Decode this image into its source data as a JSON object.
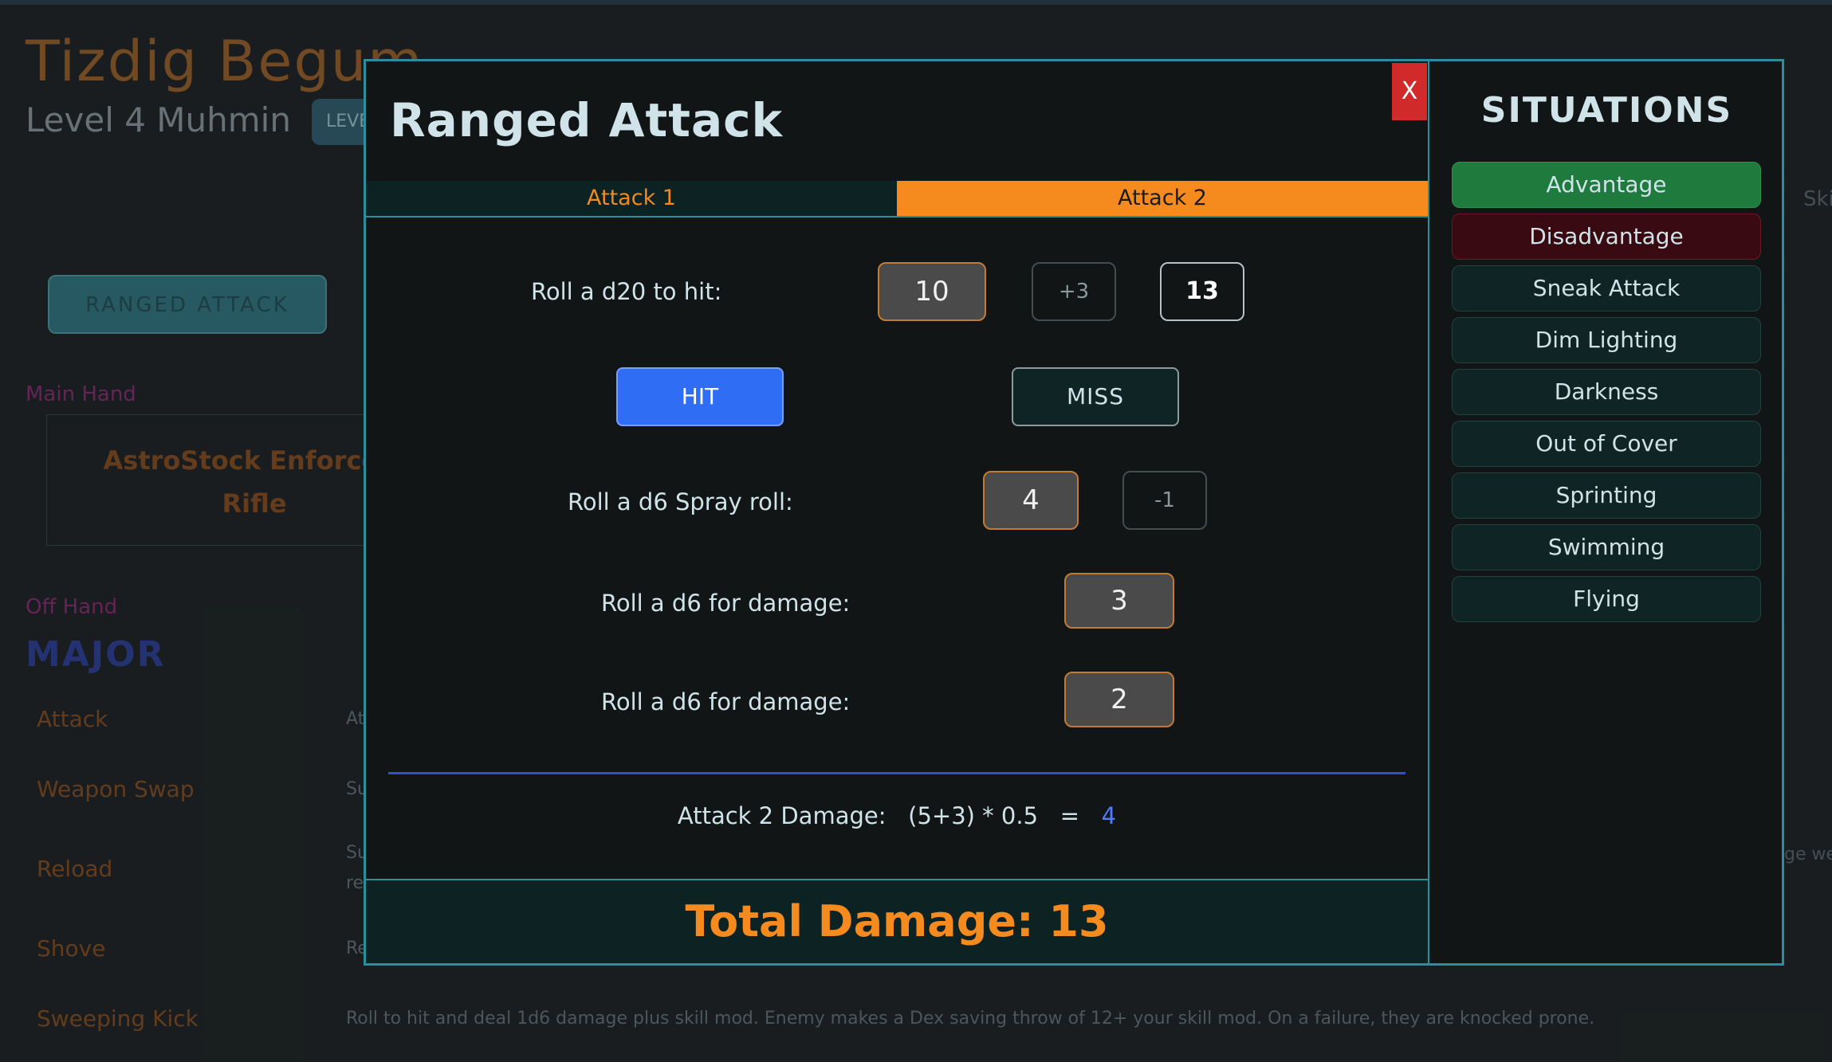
{
  "background": {
    "character_name": "Tizdig Begum",
    "character_level": "Level  4 Muhmin",
    "level_chip": "LEVE",
    "ranged_attack_button": "RANGED ATTACK",
    "main_hand_label": "Main Hand",
    "main_hand_weapon_line1": "AstroStock Enforcem",
    "main_hand_weapon_line2": "Rifle",
    "off_hand_label": "Off Hand",
    "major_heading": "MAJOR",
    "actions": [
      {
        "name": "Attack",
        "desc": "At"
      },
      {
        "name": "Weapon Swap",
        "desc": "Su"
      },
      {
        "name": "Reload",
        "desc": "Su"
      },
      {
        "name": "Shove",
        "desc": "Re"
      },
      {
        "name": "Sweeping Kick",
        "desc": "Roll to hit and deal 1d6 damage plus skill mod. Enemy makes a Dex saving throw of 12+ your skill mod. On a failure, they are knocked prone."
      }
    ],
    "reload_desc_line2": "re",
    "right_peek_top": "Ski",
    "right_peek_mid": "ge we"
  },
  "modal": {
    "title": "Ranged Attack",
    "close_label": "X",
    "tabs": [
      {
        "label": "Attack 1",
        "active": false
      },
      {
        "label": "Attack 2",
        "active": true
      }
    ],
    "to_hit": {
      "label": "Roll a d20 to hit:",
      "roll": "10",
      "modifier": "+3",
      "total": "13"
    },
    "hit_label": "HIT",
    "miss_label": "MISS",
    "spray": {
      "label": "Roll a d6 Spray roll:",
      "roll": "4",
      "modifier": "-1"
    },
    "damage_rolls": [
      {
        "label": "Roll a d6 for damage:",
        "roll": "3"
      },
      {
        "label": "Roll a d6 for damage:",
        "roll": "2"
      }
    ],
    "formula": {
      "label": "Attack 2 Damage:",
      "expression": "(5+3) * 0.5",
      "equals": "=",
      "result": "4"
    },
    "total_damage": "Total Damage: 13"
  },
  "situations": {
    "title": "SITUATIONS",
    "items": [
      {
        "label": "Advantage",
        "state": "on"
      },
      {
        "label": "Disadvantage",
        "state": "on"
      },
      {
        "label": "Sneak Attack",
        "state": "off"
      },
      {
        "label": "Dim Lighting",
        "state": "off"
      },
      {
        "label": "Darkness",
        "state": "off"
      },
      {
        "label": "Out of Cover",
        "state": "off"
      },
      {
        "label": "Sprinting",
        "state": "off"
      },
      {
        "label": "Swimming",
        "state": "off"
      },
      {
        "label": "Flying",
        "state": "off"
      }
    ]
  },
  "colors": {
    "accent_border": "#2a8f9c",
    "active_tab": "#f58a1f",
    "hit": "#2f6df5",
    "advantage": "#1f7a3e",
    "disadvantage": "#3a0a12",
    "close": "#d12a2a"
  }
}
